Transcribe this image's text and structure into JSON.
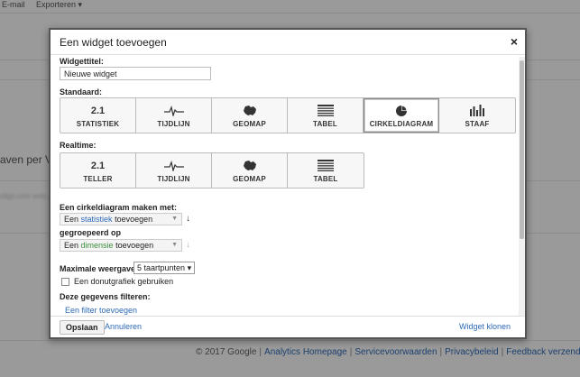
{
  "background": {
    "topbar": [
      "E-mail",
      "Exporteren ▾"
    ],
    "side_text": "aven per Vol",
    "blur_text": "sligo.com web ga",
    "footer": {
      "copyright": "© 2017 Google",
      "links": [
        "Analytics Homepage",
        "Servicevoorwaarden",
        "Privacybeleid",
        "Feedback verzenden"
      ]
    }
  },
  "dialog": {
    "title": "Een widget toevoegen",
    "close_icon": "×",
    "widget_title_label": "Widgettitel:",
    "widget_title_value": "Nieuwe widget",
    "standard_label": "Standaard:",
    "standard_types": [
      {
        "icon_text": "2.1",
        "label": "STATISTIEK",
        "icon": "number-icon"
      },
      {
        "icon_text": "",
        "label": "TIJDLIJN",
        "icon": "line-chart-icon"
      },
      {
        "icon_text": "",
        "label": "GEOMAP",
        "icon": "map-icon"
      },
      {
        "icon_text": "",
        "label": "TABEL",
        "icon": "table-icon"
      },
      {
        "icon_text": "",
        "label": "CIRKELDIAGRAM",
        "icon": "pie-chart-icon"
      },
      {
        "icon_text": "",
        "label": "STAAF",
        "icon": "bar-chart-icon"
      }
    ],
    "standard_selected": "CIRKELDIAGRAM",
    "realtime_label": "Realtime:",
    "realtime_types": [
      {
        "icon_text": "2.1",
        "label": "TELLER",
        "icon": "number-icon"
      },
      {
        "icon_text": "",
        "label": "TIJDLIJN",
        "icon": "line-chart-icon"
      },
      {
        "icon_text": "",
        "label": "GEOMAP",
        "icon": "map-icon"
      },
      {
        "icon_text": "",
        "label": "TABEL",
        "icon": "table-icon"
      }
    ],
    "pie_with_label": "Een cirkeldiagram maken met:",
    "metric_dropdown": {
      "prefix": "Een",
      "keyword": "statistiek",
      "suffix": "toevoegen"
    },
    "grouped_by_label": "gegroepeerd op",
    "dimension_dropdown": {
      "prefix": "Een",
      "keyword": "dimensie",
      "suffix": "toevoegen"
    },
    "max_display_label": "Maximale weergave:",
    "max_display_value": "5 taartpunten",
    "donut_label": "Een donutgrafiek gebruiken",
    "filter_label": "Deze gegevens filteren:",
    "add_filter_link": "Een filter toevoegen",
    "save_button": "Opslaan",
    "cancel_link": "Annuleren",
    "clone_link": "Widget klonen"
  },
  "colors": {
    "link": "#2d6bb8",
    "metric_keyword": "#2d6bb8",
    "dimension_keyword": "#3c8f3c"
  }
}
